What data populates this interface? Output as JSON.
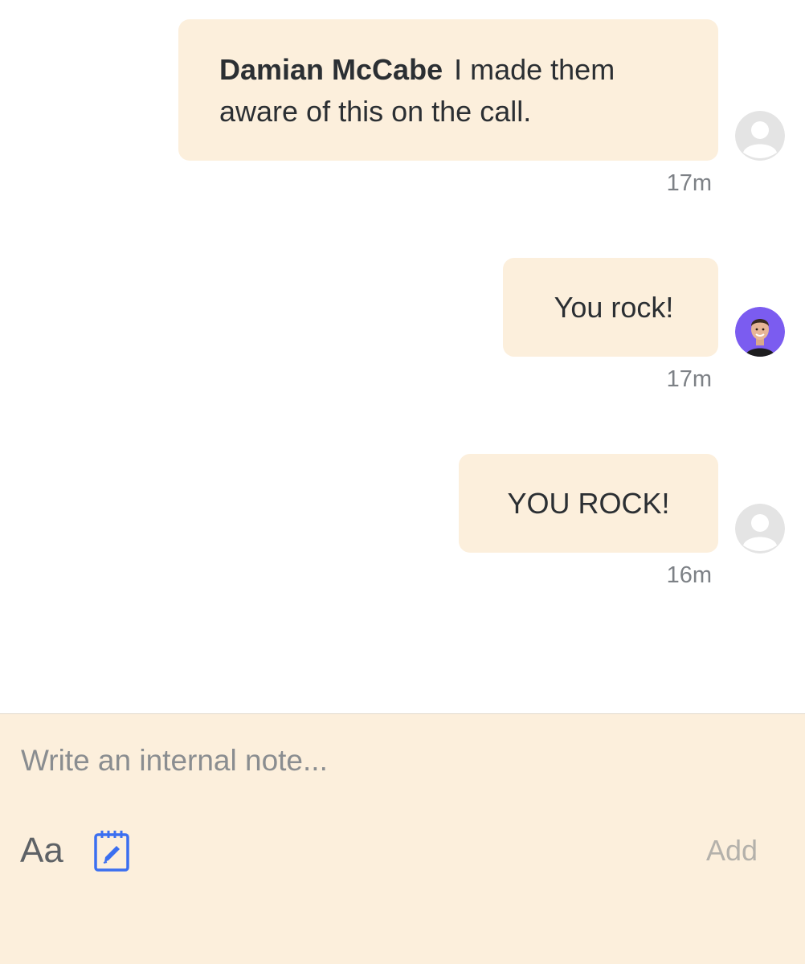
{
  "messages": [
    {
      "author": "Damian McCabe",
      "text": "I made them aware of this on the call.",
      "time": "17m",
      "avatar": "default-avatar-icon"
    },
    {
      "author": "",
      "text": "You rock!",
      "time": "17m",
      "avatar": "photo-avatar"
    },
    {
      "author": "",
      "text": "YOU ROCK!",
      "time": "16m",
      "avatar": "default-avatar-icon"
    }
  ],
  "composer": {
    "placeholder": "Write an internal note...",
    "value": "",
    "format_label": "Aa",
    "note_icon": "notepad-icon",
    "add_label": "Add"
  },
  "colors": {
    "bubble_bg": "#fcefdc",
    "composer_bg": "#fcefdc",
    "accent_blue": "#3b6ff0",
    "avatar_purple": "#7b5cf0",
    "default_avatar": "#e4e4e4",
    "disabled_text": "#b4b1ab"
  }
}
